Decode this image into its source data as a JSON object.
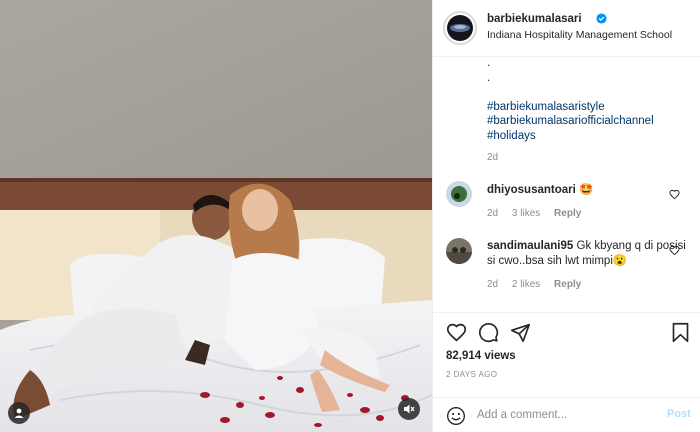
{
  "post": {
    "username": "barbiekumalasari",
    "location": "Indiana Hospitality Management School",
    "verified": true
  },
  "caption": {
    "dots": [
      ".",
      "."
    ],
    "hashtags": [
      "#barbiekumalasaristyle",
      "#barbiekumalasariofficialchannel",
      "#holidays"
    ],
    "time": "2d"
  },
  "comments": [
    {
      "user": "dhiyosusantoari",
      "text": "🤩",
      "time": "2d",
      "likes": "3 likes",
      "reply": "Reply"
    },
    {
      "user": "sandimaulani95",
      "text": "Gk kbyang q di posisi si cwo..bsa sih lwt mimpi😮",
      "time": "2d",
      "likes": "2 likes",
      "reply": "Reply"
    }
  ],
  "stats": {
    "views": "82,914 views",
    "posted": "2 DAYS AGO"
  },
  "add_comment": {
    "placeholder": "Add a comment...",
    "post_label": "Post"
  },
  "icons": {
    "user": "user-icon",
    "mute": "volume-muted-icon",
    "verified": "verified-badge-icon",
    "like": "heart-icon",
    "comment": "comment-icon",
    "share": "share-icon",
    "save": "bookmark-icon",
    "emoji": "emoji-icon"
  },
  "colors": {
    "verified": "#0095f6",
    "hashtag": "#00376b",
    "muted": "#8e8e8e",
    "post_disabled": "#b2dffc"
  }
}
